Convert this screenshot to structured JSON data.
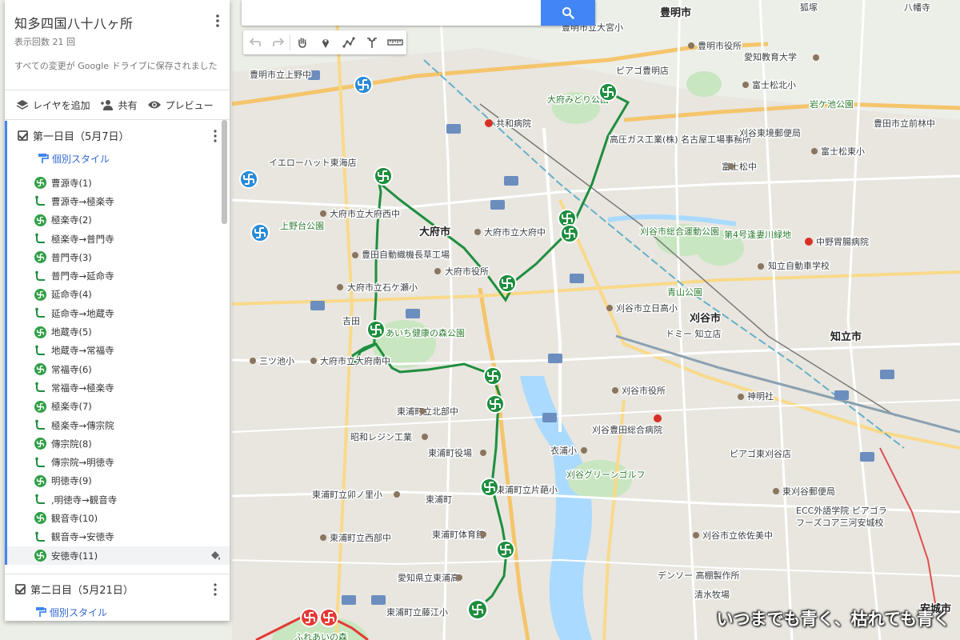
{
  "panel": {
    "title": "知多四国八十八ヶ所",
    "view_count": "表示回数 21 回",
    "save_status": "すべての変更が Google ドライブに保存されました",
    "actions": {
      "add_layer": "レイヤを追加",
      "share": "共有",
      "preview": "プレビュー"
    },
    "layer1": {
      "title": "第一日目（5月7日）",
      "style_link": "個別スタイル",
      "items": [
        {
          "type": "place",
          "label": "曹源寺(1)"
        },
        {
          "type": "route",
          "label": "曹源寺→極楽寺"
        },
        {
          "type": "place",
          "label": "極楽寺(2)"
        },
        {
          "type": "route",
          "label": "極楽寺→普門寺"
        },
        {
          "type": "place",
          "label": "普門寺(3)"
        },
        {
          "type": "route",
          "label": "普門寺→延命寺"
        },
        {
          "type": "place",
          "label": "延命寺(4)"
        },
        {
          "type": "route",
          "label": "延命寺→地蔵寺"
        },
        {
          "type": "place",
          "label": "地蔵寺(5)"
        },
        {
          "type": "route",
          "label": "地蔵寺→常福寺"
        },
        {
          "type": "place",
          "label": "常福寺(6)"
        },
        {
          "type": "route",
          "label": "常福寺→極楽寺"
        },
        {
          "type": "place",
          "label": "極楽寺(7)"
        },
        {
          "type": "route",
          "label": "極楽寺→傳宗院"
        },
        {
          "type": "place",
          "label": "傳宗院(8)"
        },
        {
          "type": "route",
          "label": "傳宗院→明徳寺"
        },
        {
          "type": "place",
          "label": "明徳寺(9)"
        },
        {
          "type": "route",
          "label": ",明徳寺→観音寺"
        },
        {
          "type": "place",
          "label": "観音寺(10)"
        },
        {
          "type": "route",
          "label": "観音寺→安徳寺"
        },
        {
          "type": "place",
          "label": "安徳寺(11)"
        }
      ]
    },
    "layer2": {
      "title": "第二日目（5月21日）",
      "style_link": "個別スタイル"
    }
  },
  "search": {
    "placeholder": ""
  },
  "toolbar": {
    "tools": [
      "undo-icon",
      "redo-icon",
      "pan-hand-icon",
      "marker-icon",
      "draw-line-icon",
      "directions-icon",
      "ruler-icon"
    ]
  },
  "map": {
    "labels": {
      "toyoake": "豊明市",
      "obu": "大府市",
      "kariya": "刈谷市",
      "chiryu": "知立市",
      "toyoake_office": "豊明市役所",
      "obu_office": "大府市役所",
      "kariya_office": "刈谷市役所",
      "toyoake_hospital": "共和病院",
      "obu_nishi": "大府市立大府西中",
      "obu_chu": "大府市立大府中",
      "yellow_hat": "イエローハット東海店",
      "uenodai_park": "上野台公園",
      "toyota_loom": "豊田自動織機長草工場",
      "ishigase": "大府市立石ケ瀬小",
      "yoshida": "吉田",
      "health_forest": "あいち健康の森公園",
      "mitsume": "三ツ池小",
      "obu_minami": "大府市立大府南中",
      "higashiura_kita": "東浦町立北部中",
      "showa_resin": "昭和レジン工業",
      "higashiura_office": "東浦町役場",
      "unonoike": "東浦町立卯ノ里小",
      "higashiura": "東浦町",
      "katahoko": "東浦町立片葩小",
      "seibu_chu": "東浦町立西部中",
      "gym": "東浦町体育館",
      "higashiura_high": "愛知県立東浦高",
      "fujie": "東浦町立藤江小",
      "fureai": "ふれあいの森",
      "kinuura": "衣浦小",
      "kariya_green": "刈谷グリーンゴルフ",
      "kariya_hospital": "刈谷豊田総合病院",
      "piago_kariya": "ピアゴ東刈谷店",
      "kariya_post": "東刈谷郵便局",
      "ecc": "ECC外語学院 ピアゴラ",
      "futures": "フーズコア三河安城校",
      "izumi": "刈谷市立依佐美中",
      "denso": "デンソー 高棚製作所",
      "shimizu": "清水牧場",
      "anjo": "安城市",
      "obu_midori": "大府みどり公園",
      "kototo_gas": "高圧ガス工業(株) 名古屋工場事務所",
      "aichi_edu": "愛知教育大学",
      "fujimatsu": "富士松北小",
      "iwagaike": "岩ケ池公園",
      "higashisakai": "刈谷東境郵便局",
      "maemichi": "豊田市立前林中",
      "fujimatsu_higashi": "富士松東小",
      "fujimatsu_chu": "富士松中",
      "sogo_park": "刈谷市総合運動公園",
      "kawaryoku": "第4号逢妻川緑地",
      "nakano": "中野胃腸病院",
      "chiryu_tech": "知立自動車学校",
      "aoyama": "青山公園",
      "kariya_shigaki": "刈谷市立日高小",
      "domy": "ドミー 知立店",
      "shinmei": "神明社",
      "toyoake_kamijo": "豊明市立上野中",
      "toyoake_ozeki": "豊明市立大宮小",
      "piago_toyoake": "ピアゴ豊明店",
      "kitsune": "狐塚",
      "hachiken": "八幡寺"
    }
  },
  "watermark": "いつまでも青く、枯れても青く"
}
